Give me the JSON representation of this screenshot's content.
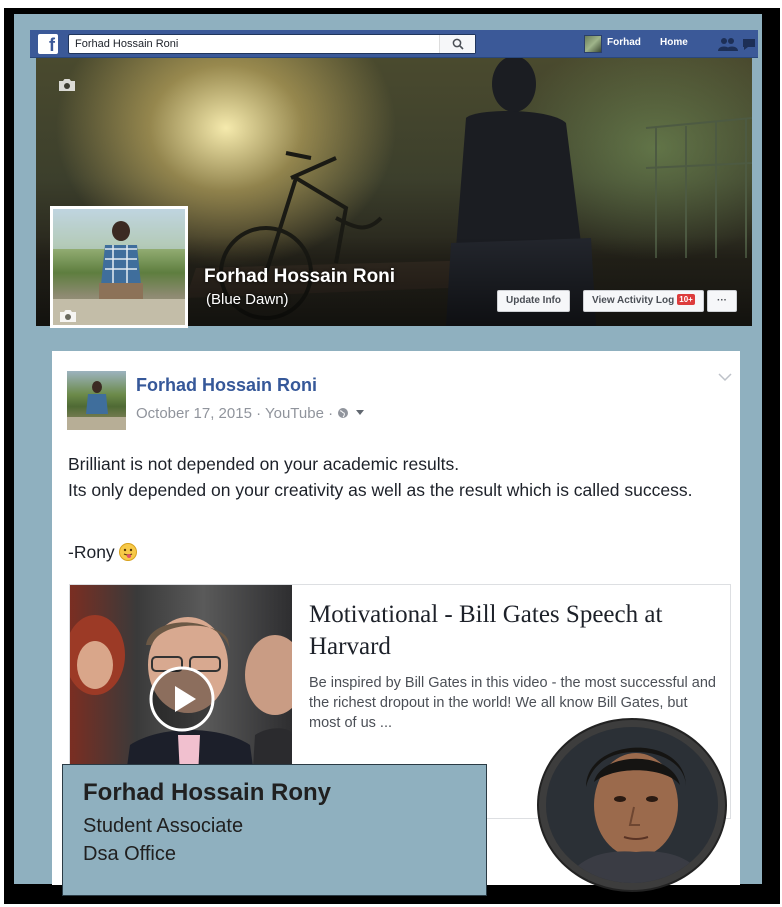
{
  "topbar": {
    "logo": "f",
    "search_value": "Forhad Hossain Roni",
    "profile_label": "Forhad",
    "home_label": "Home",
    "brand_color": "#3b5998"
  },
  "cover": {
    "name": "Forhad Hossain Roni",
    "alt_name": "(Blue Dawn)",
    "update_info_label": "Update Info",
    "activity_log_label": "View Activity Log",
    "activity_badge": "10+",
    "more_label": "···"
  },
  "post": {
    "author": "Forhad Hossain Roni",
    "meta": "October 17, 2015 · YouTube · ",
    "body_line1": "Brilliant is not depended on your academic results.",
    "body_line2": "Its only depended on your creativity as well as the result which is called success.",
    "signature": "-Rony",
    "link": {
      "title": "Motivational - Bill Gates Speech at Harvard",
      "description": "Be inspired by Bill Gates in this video - the most successful and the richest dropout in the world! We all know Bill Gates, but most of us ..."
    }
  },
  "name_card": {
    "name": "Forhad Hossain Rony",
    "role": "Student Associate",
    "office": "Dsa Office"
  },
  "colors": {
    "panel": "#8fb0bf",
    "link_blue": "#365899"
  }
}
